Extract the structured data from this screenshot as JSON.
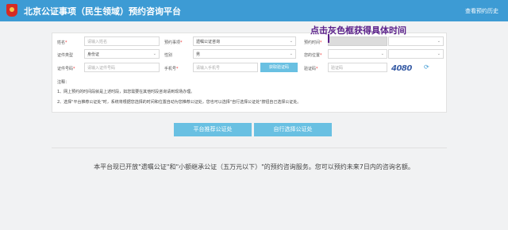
{
  "header": {
    "title": "北京公证事项（民生领域）预约咨询平台",
    "history_link": "查看预约历史"
  },
  "form": {
    "name_label": "姓名",
    "name_placeholder": "请输入姓名",
    "matter_label": "预约事项",
    "matter_value": "遗嘱公证咨询",
    "time_label": "预约时间",
    "id_type_label": "证件类型",
    "id_type_value": "身份证",
    "gender_label": "性别",
    "gender_value": "男",
    "location_label": "您的位置",
    "id_number_label": "证件号码",
    "id_number_placeholder": "请输入证件号码",
    "phone_label": "手机号",
    "phone_placeholder": "请输入手机号",
    "get_code_button": "获取验证码",
    "verify_label": "验证码",
    "verify_placeholder": "验证码",
    "captcha_text": "4080"
  },
  "annotation": "点击灰色框获得具体时间",
  "notes": {
    "title": "注释：",
    "items": [
      "1、网上预约的时间段就是上述时段，如您需要在其他时段咨询请到现场办理。",
      "2、选择\"平台推荐公证处\"时，系统将根据您选择的时间和位置自动为您推荐公证处，您也可以选择\"自行选择公证处\"按钮自己选择公证处。"
    ]
  },
  "buttons": {
    "platform": "平台推荐公证处",
    "self": "自行选择公证处"
  },
  "info": "本平台现已开放\"遗嘱公证\"和\"小额继承公证（五万元以下）\"的预约咨询服务。您可以预约未来7日内的咨询名额。"
}
